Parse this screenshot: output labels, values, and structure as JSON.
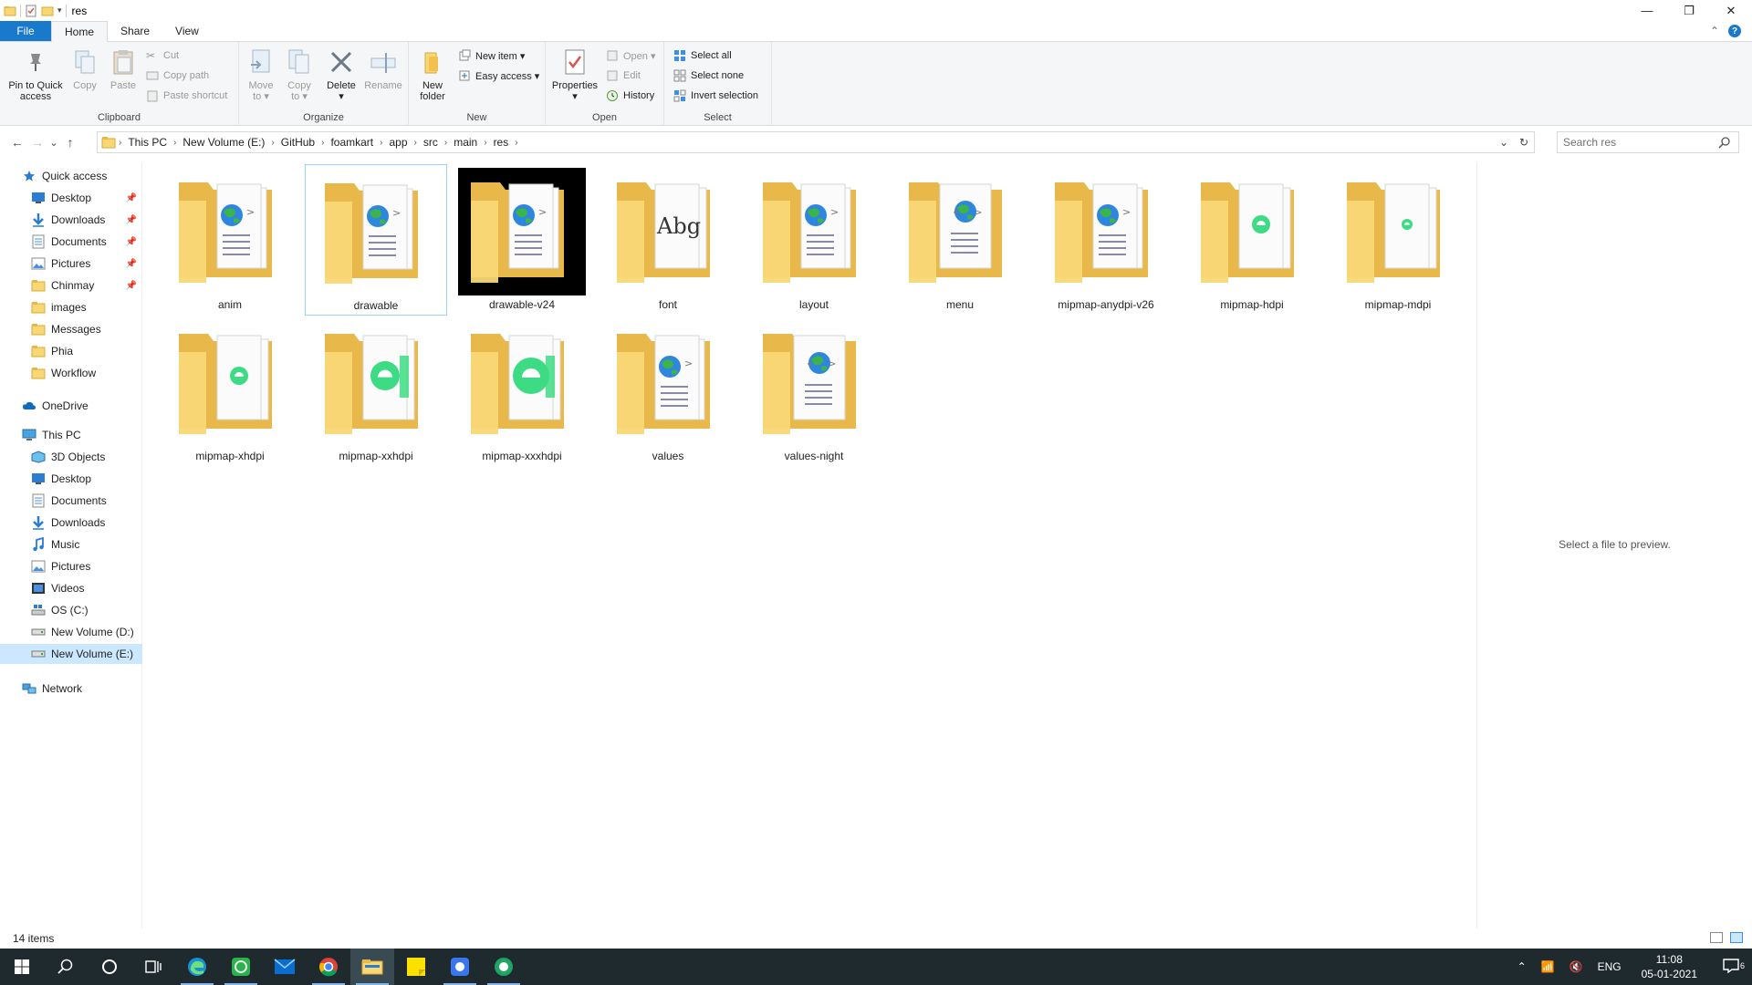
{
  "window": {
    "title": "res",
    "qat_sep": "|",
    "controls": {
      "minimize": "—",
      "maximize": "❐",
      "close": "✕"
    }
  },
  "ribbon": {
    "tabs": [
      "File",
      "Home",
      "Share",
      "View"
    ],
    "collapse_glyph": "⌃",
    "help": "?",
    "clipboard": {
      "label": "Clipboard",
      "pin": "Pin to Quick\naccess",
      "copy": "Copy",
      "paste": "Paste",
      "cut": "Cut",
      "copy_path": "Copy path",
      "paste_shortcut": "Paste shortcut"
    },
    "organize": {
      "label": "Organize",
      "move_to": "Move\nto ▾",
      "copy_to": "Copy\nto ▾",
      "delete": "Delete\n▾",
      "rename": "Rename"
    },
    "new": {
      "label": "New",
      "new_folder": "New\nfolder",
      "new_item": "New item ▾",
      "easy_access": "Easy access ▾"
    },
    "open": {
      "label": "Open",
      "properties": "Properties\n▾",
      "open": "Open ▾",
      "edit": "Edit",
      "history": "History"
    },
    "select": {
      "label": "Select",
      "select_all": "Select all",
      "select_none": "Select none",
      "invert": "Invert selection"
    }
  },
  "nav_glyphs": {
    "back": "←",
    "forward": "→",
    "recent": "⌄",
    "up": "↑",
    "dropdown": "⌄",
    "refresh": "↻"
  },
  "breadcrumbs": [
    "This PC",
    "New Volume (E:)",
    "GitHub",
    "foamkart",
    "app",
    "src",
    "main",
    "res"
  ],
  "crumb_sep": "›",
  "search": {
    "placeholder": "Search res"
  },
  "navpane": {
    "quick_access": "Quick access",
    "quick_items": [
      {
        "label": "Desktop",
        "pinned": true
      },
      {
        "label": "Downloads",
        "pinned": true
      },
      {
        "label": "Documents",
        "pinned": true
      },
      {
        "label": "Pictures",
        "pinned": true
      },
      {
        "label": "Chinmay",
        "pinned": true
      },
      {
        "label": "images",
        "pinned": false
      },
      {
        "label": "Messages",
        "pinned": false
      },
      {
        "label": "Phia",
        "pinned": false
      },
      {
        "label": "Workflow",
        "pinned": false
      }
    ],
    "pin_glyph": "📌",
    "onedrive": "OneDrive",
    "this_pc": "This PC",
    "pc_items": [
      "3D Objects",
      "Desktop",
      "Documents",
      "Downloads",
      "Music",
      "Pictures",
      "Videos",
      "OS (C:)",
      "New Volume (D:)",
      "New Volume (E:)"
    ],
    "network": "Network"
  },
  "folders": [
    {
      "name": "anim",
      "kind": "web"
    },
    {
      "name": "drawable",
      "kind": "web"
    },
    {
      "name": "drawable-v24",
      "kind": "web-dark"
    },
    {
      "name": "font",
      "kind": "font"
    },
    {
      "name": "layout",
      "kind": "web"
    },
    {
      "name": "menu",
      "kind": "web-single"
    },
    {
      "name": "mipmap-anydpi-v26",
      "kind": "web"
    },
    {
      "name": "mipmap-hdpi",
      "kind": "android-small"
    },
    {
      "name": "mipmap-mdpi",
      "kind": "android-tiny"
    },
    {
      "name": "mipmap-xhdpi",
      "kind": "android-small"
    },
    {
      "name": "mipmap-xxhdpi",
      "kind": "android-big"
    },
    {
      "name": "mipmap-xxxhdpi",
      "kind": "android-bigger"
    },
    {
      "name": "values",
      "kind": "web"
    },
    {
      "name": "values-night",
      "kind": "web-single"
    }
  ],
  "font_thumb": {
    "text": "Abg"
  },
  "preview": "Select a file to preview.",
  "status": {
    "items": "14 items"
  },
  "taskbar": {
    "clock_time": "11:08",
    "clock_date": "05-01-2021",
    "lang": "ENG",
    "tray_up": "⌃",
    "notif_count": "6"
  },
  "colors": {
    "accent": "#1979ca",
    "folder": "#f8d775",
    "folder_dark": "#e8b84a",
    "selected": "#cce8ff"
  }
}
